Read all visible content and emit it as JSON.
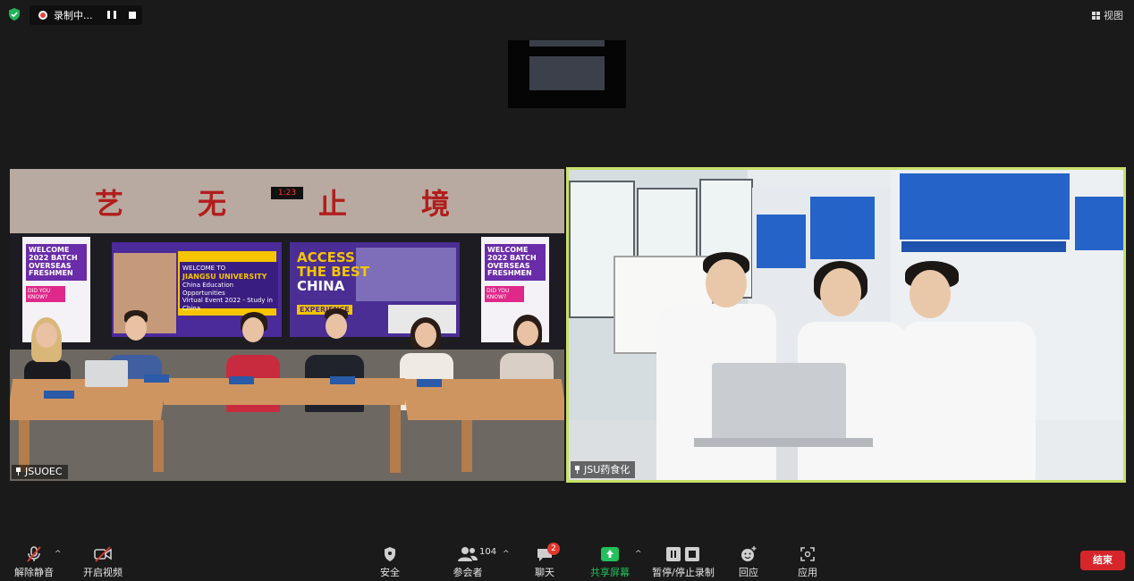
{
  "recording": {
    "label": "录制中..."
  },
  "view": {
    "label": "视图"
  },
  "tiles": [
    {
      "name": "JSUOEC"
    },
    {
      "name": "JSU药食化"
    }
  ],
  "scene": {
    "calligraphy": [
      "艺",
      "无",
      "止",
      "境"
    ],
    "clock": "1:23",
    "banner_left": {
      "line1": "WELCOME",
      "line2": "2022 BATCH",
      "line3": "OVERSEAS",
      "line4": "FRESHMEN",
      "pink": "DID YOU KNOW?"
    },
    "banner_right": {
      "line1": "WELCOME",
      "line2": "2022 BATCH",
      "line3": "OVERSEAS",
      "line4": "FRESHMEN",
      "pink": "DID YOU KNOW?"
    },
    "slide1": {
      "line1": "WELCOME TO",
      "line2": "JIANGSU UNIVERSITY",
      "line3": "China Education Opportunities",
      "line4": "Virtual Event 2022 - Study in China"
    },
    "slide2": {
      "line1": "ACCESS",
      "line2": "THE BEST",
      "line3": "CHINA",
      "line4": "EXPERIENCE"
    }
  },
  "toolbar": {
    "unmute": "解除静音",
    "start_video": "开启视频",
    "security": "安全",
    "participants": "参会者",
    "participants_count": "104",
    "chat": "聊天",
    "chat_badge": "2",
    "share_screen": "共享屏幕",
    "record": "暂停/停止录制",
    "reactions": "回应",
    "apps": "应用",
    "end": "结束"
  },
  "colors": {
    "active_speaker_border": "#c8e06a",
    "share_green": "#23c05b",
    "end_red": "#d7262b"
  },
  "icons": [
    "shield-icon",
    "record-icon",
    "pause-icon",
    "stop-icon",
    "grid-view-icon",
    "microphone-muted-icon",
    "camera-off-icon",
    "shield-security-icon",
    "participants-icon",
    "chat-icon",
    "share-screen-icon",
    "record-control-icon",
    "reaction-icon",
    "apps-icon",
    "pin-icon"
  ]
}
